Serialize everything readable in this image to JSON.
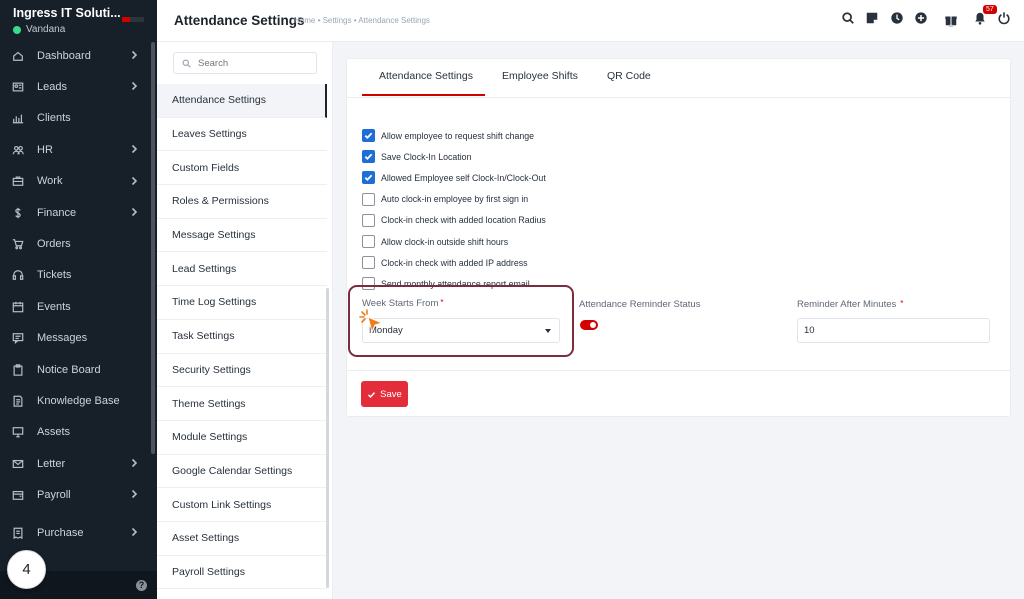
{
  "app": {
    "company": "Ingress IT Soluti...",
    "user": "Vandana"
  },
  "sidebar": {
    "items": [
      {
        "label": "Dashboard",
        "icon": "house-icon",
        "chevron": true
      },
      {
        "label": "Leads",
        "icon": "contact-card-icon",
        "chevron": true
      },
      {
        "label": "Clients",
        "icon": "bar-chart-icon",
        "chevron": false
      },
      {
        "label": "HR",
        "icon": "users-icon",
        "chevron": true
      },
      {
        "label": "Work",
        "icon": "briefcase-icon",
        "chevron": true
      },
      {
        "label": "Finance",
        "icon": "dollar-icon",
        "chevron": true
      },
      {
        "label": "Orders",
        "icon": "cart-icon",
        "chevron": false
      },
      {
        "label": "Tickets",
        "icon": "headset-icon",
        "chevron": false
      },
      {
        "label": "Events",
        "icon": "calendar-icon",
        "chevron": false
      },
      {
        "label": "Messages",
        "icon": "chat-icon",
        "chevron": false
      },
      {
        "label": "Notice Board",
        "icon": "clipboard-icon",
        "chevron": false
      },
      {
        "label": "Knowledge Base",
        "icon": "book-icon",
        "chevron": false
      },
      {
        "label": "Assets",
        "icon": "monitor-icon",
        "chevron": false
      },
      {
        "label": "Letter",
        "icon": "envelope-icon",
        "chevron": true
      },
      {
        "label": "Payroll",
        "icon": "wallet-icon",
        "chevron": true
      },
      {
        "label": "Purchase",
        "icon": "receipt-icon",
        "chevron": true
      }
    ],
    "help": "?"
  },
  "step_badge": "4",
  "header": {
    "title": "Attendance Settings",
    "breadcrumb": "Home • Settings • Attendance Settings",
    "notification_count": "57"
  },
  "subnav": {
    "search_placeholder": "Search",
    "items": [
      "Attendance Settings",
      "Leaves Settings",
      "Custom Fields",
      "Roles & Permissions",
      "Message Settings",
      "Lead Settings",
      "Time Log Settings",
      "Task Settings",
      "Security Settings",
      "Theme Settings",
      "Module Settings",
      "Google Calendar Settings",
      "Custom Link Settings",
      "Asset Settings",
      "Payroll Settings"
    ],
    "active_index": 0
  },
  "tabs": [
    "Attendance Settings",
    "Employee Shifts",
    "QR Code"
  ],
  "checkboxes": [
    {
      "label": "Allow employee to request shift change",
      "checked": true
    },
    {
      "label": "Save Clock-In Location",
      "checked": true
    },
    {
      "label": "Allowed Employee self Clock-In/Clock-Out",
      "checked": true
    },
    {
      "label": "Auto clock-in employee by first sign in",
      "checked": false
    },
    {
      "label": "Clock-in check with added location Radius",
      "checked": false
    },
    {
      "label": "Allow clock-in outside shift hours",
      "checked": false
    },
    {
      "label": "Clock-in check with added IP address",
      "checked": false
    },
    {
      "label": "Send monthly attendance report email",
      "checked": false
    }
  ],
  "form": {
    "week_starts_label": "Week Starts From",
    "week_starts_value": "Monday",
    "required_mark": "*",
    "reminder_status_label": "Attendance Reminder Status",
    "reminder_status_on": true,
    "reminder_minutes_label": "Reminder After Minutes",
    "reminder_minutes_value": "10"
  },
  "save_label": "Save",
  "colors": {
    "sidebar_bg": "#171f29",
    "accent_red": "#d30000",
    "save_red": "#e42d3a",
    "checkbox_blue": "#1e6ed8",
    "highlight": "#7b2d3f",
    "online": "#39da8a"
  }
}
